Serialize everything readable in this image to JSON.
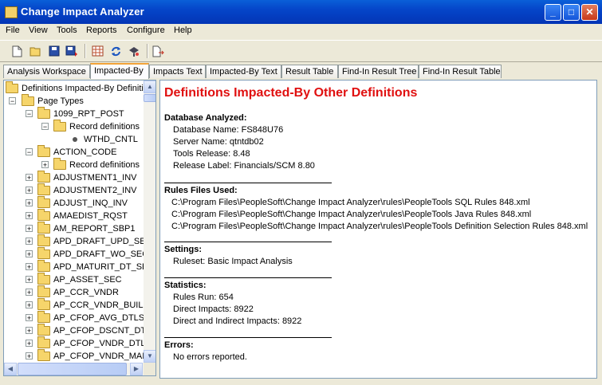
{
  "window": {
    "title": "Change Impact Analyzer",
    "minimize_label": "_",
    "maximize_label": "□",
    "close_label": "✕"
  },
  "menu": [
    "File",
    "View",
    "Tools",
    "Reports",
    "Configure",
    "Help"
  ],
  "tabs": [
    {
      "label": "Analysis Workspace",
      "active": false
    },
    {
      "label": "Impacted-By",
      "active": true
    },
    {
      "label": "Impacts Text",
      "active": false
    },
    {
      "label": "Impacted-By Text",
      "active": false
    },
    {
      "label": "Result Table",
      "active": false
    },
    {
      "label": "Find-In Result Tree",
      "active": false
    },
    {
      "label": "Find-In Result Table",
      "active": false
    }
  ],
  "tree": {
    "root": "Definitions Impacted-By Definitio",
    "page_types": "Page Types",
    "items": [
      {
        "label": "1099_RPT_POST",
        "state": "expanded"
      },
      {
        "label": "Record definitions",
        "state": "expanded",
        "level": 2
      },
      {
        "label": "WTHD_CNTL",
        "state": "leaf",
        "level": 3
      },
      {
        "label": "ACTION_CODE",
        "state": "expanded"
      },
      {
        "label": "Record definitions",
        "state": "collapsed",
        "level": 2
      },
      {
        "label": "ADJUSTMENT1_INV",
        "state": "collapsed"
      },
      {
        "label": "ADJUSTMENT2_INV",
        "state": "collapsed"
      },
      {
        "label": "ADJUST_INQ_INV",
        "state": "collapsed"
      },
      {
        "label": "AMAEDIST_RQST",
        "state": "collapsed"
      },
      {
        "label": "AM_REPORT_SBP1",
        "state": "collapsed"
      },
      {
        "label": "APD_DRAFT_UPD_SEC",
        "state": "collapsed"
      },
      {
        "label": "APD_DRAFT_WO_SEC",
        "state": "collapsed"
      },
      {
        "label": "APD_MATURIT_DT_SEC",
        "state": "collapsed"
      },
      {
        "label": "AP_ASSET_SEC",
        "state": "collapsed"
      },
      {
        "label": "AP_CCR_VNDR",
        "state": "collapsed"
      },
      {
        "label": "AP_CCR_VNDR_BUILD",
        "state": "collapsed"
      },
      {
        "label": "AP_CFOP_AVG_DTLS",
        "state": "collapsed"
      },
      {
        "label": "AP_CFOP_DSCNT_DTL",
        "state": "collapsed"
      },
      {
        "label": "AP_CFOP_VNDR_DTLS",
        "state": "collapsed"
      },
      {
        "label": "AP_CFOP_VNDR_MAIN",
        "state": "collapsed"
      }
    ]
  },
  "report": {
    "title": "Definitions Impacted-By Other Definitions",
    "database": {
      "heading": "Database Analyzed:",
      "lines": [
        "Database Name: FS848U76",
        "Server Name: qtntdb02",
        "Tools Release: 8.48",
        "Release Label: Financials/SCM 8.80"
      ]
    },
    "rules": {
      "heading": "Rules Files Used:",
      "lines": [
        "C:\\Program Files\\PeopleSoft\\Change Impact Analyzer\\rules\\PeopleTools SQL Rules 848.xml",
        "C:\\Program Files\\PeopleSoft\\Change Impact Analyzer\\rules\\PeopleTools Java Rules 848.xml",
        "C:\\Program Files\\PeopleSoft\\Change Impact Analyzer\\rules\\PeopleTools Definition Selection Rules 848.xml"
      ]
    },
    "settings": {
      "heading": "Settings:",
      "lines": [
        "Ruleset: Basic Impact Analysis"
      ]
    },
    "statistics": {
      "heading": "Statistics:",
      "lines": [
        "Rules Run: 654",
        "Direct Impacts: 8922",
        "Direct and Indirect Impacts: 8922"
      ]
    },
    "errors": {
      "heading": "Errors:",
      "lines": [
        "No errors reported."
      ]
    }
  }
}
